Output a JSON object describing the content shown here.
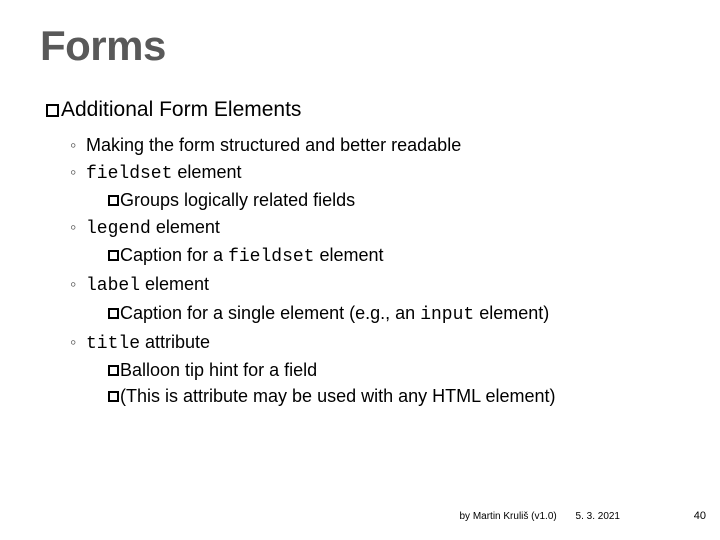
{
  "title": "Forms",
  "subheading": "Additional Form Elements",
  "items": [
    {
      "text": "Making the form structured and better readable",
      "sub": []
    },
    {
      "code": "fieldset",
      "text": " element",
      "sub": [
        {
          "text": "Groups logically related fields"
        }
      ]
    },
    {
      "code": "legend",
      "text": " element",
      "sub": [
        {
          "pre": "Caption for a ",
          "code": "fieldset",
          "post": " element"
        }
      ]
    },
    {
      "code": "label",
      "text": " element",
      "sub": [
        {
          "pre": "Caption for a single element (e.g., an ",
          "code": "input",
          "post": " element)"
        }
      ]
    },
    {
      "code": "title",
      "text": " attribute",
      "sub": [
        {
          "text": "Balloon tip hint for a field"
        },
        {
          "text": "(This is attribute may be used with any HTML element)"
        }
      ]
    }
  ],
  "footer": {
    "author": "by Martin Kruliš (v1.0)",
    "date": "5. 3. 2021",
    "page": "40"
  }
}
